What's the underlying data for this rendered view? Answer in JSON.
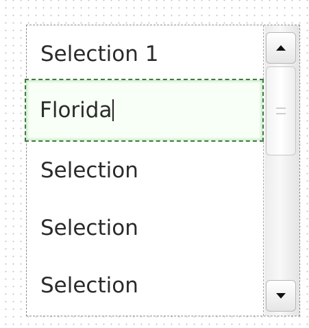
{
  "listbox": {
    "items": [
      {
        "label": "Selection 1"
      },
      {
        "label": "Florida",
        "editing": true
      },
      {
        "label": "Selection"
      },
      {
        "label": "Selection"
      },
      {
        "label": "Selection"
      }
    ]
  },
  "scrollbar": {
    "up_icon": "arrow-up-icon",
    "down_icon": "arrow-down-icon",
    "thumb_icon": "grip-icon"
  },
  "colors": {
    "edit_border": "#3d7a3d",
    "edit_background": "#f7fff6",
    "text": "#2a2a2a"
  }
}
